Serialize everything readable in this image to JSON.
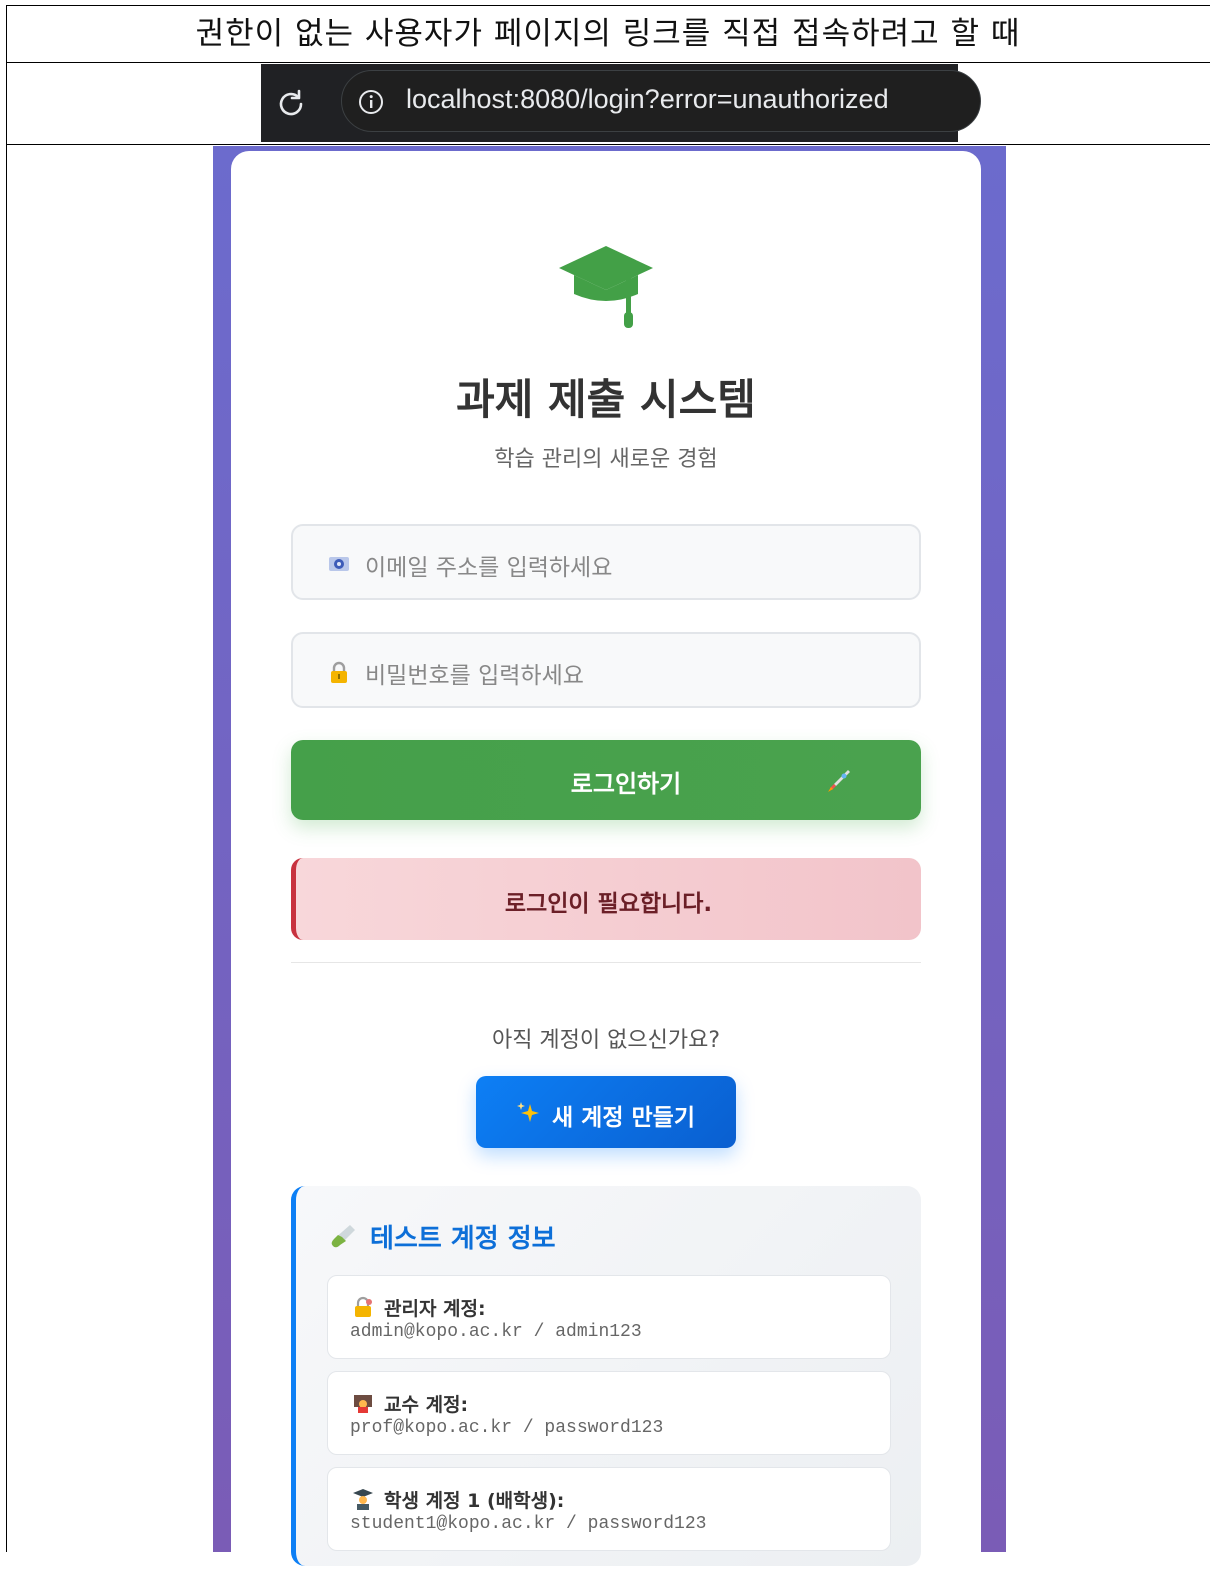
{
  "document": {
    "caption": "권한이 없는 사용자가 페이지의 링크를 직접 접속하려고 할 때"
  },
  "browser": {
    "url": "localhost:8080/login?error=unauthorized",
    "icons": [
      "reload-icon",
      "info-icon"
    ]
  },
  "login": {
    "app_title": "과제 제출 시스템",
    "app_subtitle": "학습 관리의 새로운 경험",
    "logo_icon": "graduation-cap-icon",
    "email_placeholder": "이메일 주소를 입력하세요",
    "email_icon": "email-icon",
    "password_placeholder": "비밀번호를 입력하세요",
    "password_icon": "lock-icon",
    "login_button": "로그인하기",
    "login_button_icon": "rocket-icon",
    "error_message": "로그인이 필요합니다.",
    "signup_question": "아직 계정이 없으신가요?",
    "signup_button": "새 계정 만들기",
    "signup_button_icon": "sparkles-icon",
    "test_accounts": {
      "title": "테스트 계정 정보",
      "title_icon": "test-tube-icon",
      "items": [
        {
          "icon": "admin-lock-icon",
          "label": "관리자 계정:",
          "credentials": "admin@kopo.ac.kr / admin123"
        },
        {
          "icon": "teacher-icon",
          "label": "교수 계정:",
          "credentials": "prof@kopo.ac.kr / password123"
        },
        {
          "icon": "student-icon",
          "label": "학생 계정 1 (배학생):",
          "credentials": "student1@kopo.ac.kr / password123"
        }
      ]
    }
  },
  "colors": {
    "primary_green": "#45a04a",
    "primary_blue": "#0d7ff5",
    "alert_bg": "#f8d7da",
    "alert_border": "#c8323f",
    "page_gradient_start": "#6c6bcd",
    "page_gradient_end": "#7a5cb6"
  }
}
